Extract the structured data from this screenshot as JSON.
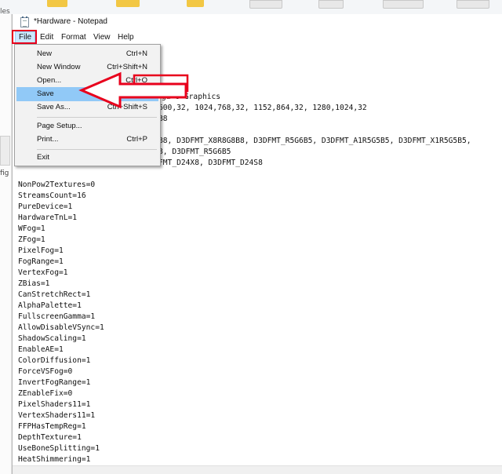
{
  "desktop": {
    "items": [
      "les"
    ]
  },
  "left_panel": {
    "label": "fig"
  },
  "window": {
    "title": "*Hardware - Notepad"
  },
  "menubar": {
    "items": [
      "File",
      "Edit",
      "Format",
      "View",
      "Help"
    ]
  },
  "file_menu": {
    "items": [
      {
        "label": "New",
        "shortcut": "Ctrl+N"
      },
      {
        "label": "New Window",
        "shortcut": "Ctrl+Shift+N"
      },
      {
        "label": "Open...",
        "shortcut": "Ctrl+O"
      },
      {
        "label": "Save",
        "shortcut": "Ctrl+S"
      },
      {
        "label": "Save As...",
        "shortcut": "Ctrl+Shift+S"
      },
      {
        "label": "Page Setup...",
        "shortcut": ""
      },
      {
        "label": "Print...",
        "shortcut": "Ctrl+P"
      },
      {
        "label": "Exit",
        "shortcut": ""
      }
    ],
    "selected": "Save"
  },
  "editor": {
    "partial_lines": [
      "ga 8 Graphics",
      "600,32, 1024,768,32, 1152,864,32, 1280,1024,32",
      "B8",
      "B8, D3DFMT_X8R8G8B8, D3DFMT_R5G6B5, D3DFMT_A1R5G5B5, D3DFMT_X1R5G5B5,",
      "8, D3DFMT_R5G6B5",
      "FMT_D24X8, D3DFMT_D24S8"
    ],
    "lines": [
      "NonPow2Textures=0",
      "StreamsCount=16",
      "PureDevice=1",
      "HardwareTnL=1",
      "WFog=1",
      "ZFog=1",
      "PixelFog=1",
      "FogRange=1",
      "VertexFog=1",
      "ZBias=1",
      "CanStretchRect=1",
      "AlphaPalette=1",
      "FullscreenGamma=1",
      "AllowDisableVSync=1",
      "ShadowScaling=1",
      "EnableAE=1",
      "ColorDiffusion=1",
      "ForceVSFog=0",
      "InvertFogRange=1",
      "ZEnableFix=0",
      "PixelShaders11=1",
      "VertexShaders11=1",
      "FFPHasTempReg=1",
      "DepthTexture=1",
      "UseBoneSplitting=1",
      "HeatShimmering=1"
    ]
  },
  "annotation": {
    "color": "#e8001c"
  }
}
